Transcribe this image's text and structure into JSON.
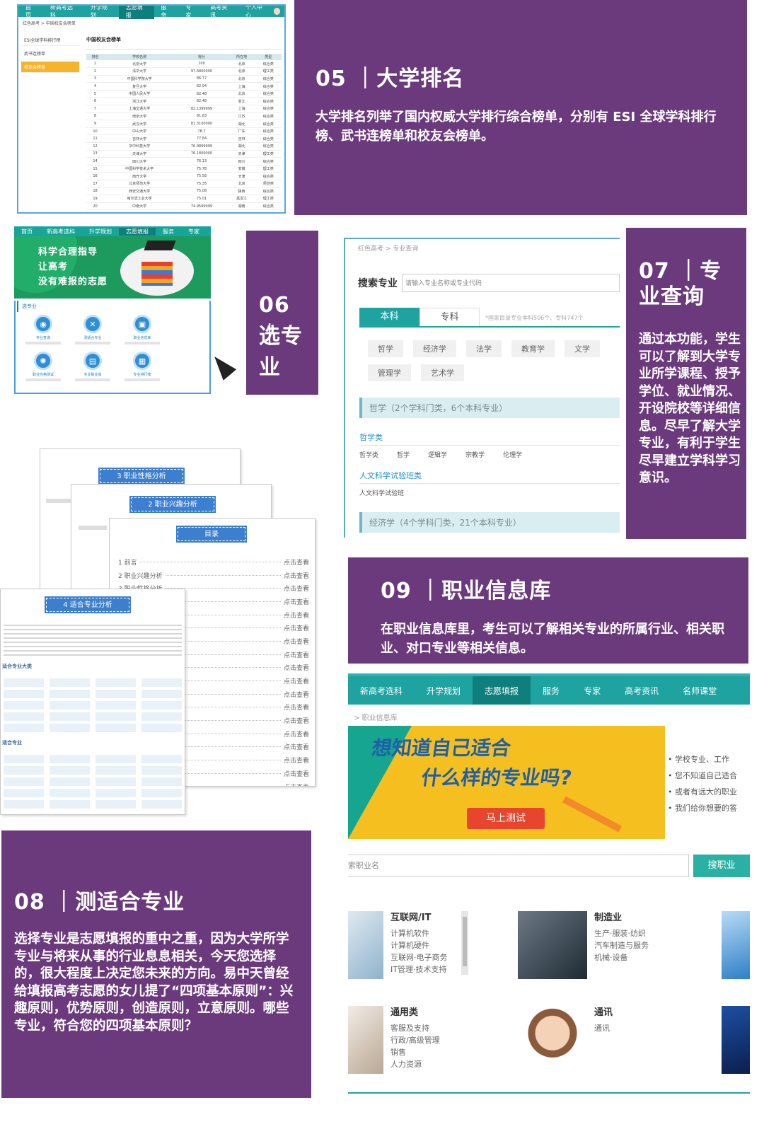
{
  "s05": {
    "title": "05 ｜大学排名",
    "body": "大学排名列举了国内权威大学排行综合榜单，分别有 ESI 全球学科排行榜、武书连榜单和校友会榜单。",
    "shot": {
      "nav": [
        "首页",
        "新高考选科",
        "升学规划",
        "志愿填报",
        "服务",
        "专家",
        "高考资讯"
      ],
      "nav_active": 3,
      "user": "个人中心",
      "breadcrumb": "红色高考 > 中国校友会榜单",
      "sidebar": [
        "ESI全球学科排行榜",
        "武书连榜单",
        "校友会榜单"
      ],
      "sidebar_active": 2,
      "panel_title": "中国校友会榜单",
      "columns": [
        "排名",
        "学校名称",
        "得分",
        "所在地",
        "类型"
      ],
      "rows": [
        [
          "1",
          "北京大学",
          "100",
          "北京",
          "综合类"
        ],
        [
          "2",
          "清华大学",
          "97.6800000",
          "北京",
          "理工类"
        ],
        [
          "3",
          "中国科学院大学",
          "86.77",
          "北京",
          "综合类"
        ],
        [
          "4",
          "复旦大学",
          "82.94",
          "上海",
          "综合类"
        ],
        [
          "5",
          "中国人民大学",
          "82.48",
          "北京",
          "综合类"
        ],
        [
          "6",
          "浙江大学",
          "82.48",
          "浙江",
          "综合类"
        ],
        [
          "7",
          "上海交通大学",
          "82.1399999",
          "上海",
          "综合类"
        ],
        [
          "8",
          "南京大学",
          "81.83",
          "江苏",
          "综合类"
        ],
        [
          "9",
          "武汉大学",
          "81.3100000",
          "湖北",
          "综合类"
        ],
        [
          "10",
          "中山大学",
          "78.7",
          "广东",
          "综合类"
        ],
        [
          "11",
          "吉林大学",
          "77.84",
          "吉林",
          "综合类"
        ],
        [
          "12",
          "华中科技大学",
          "76.9899999",
          "湖北",
          "综合类"
        ],
        [
          "13",
          "天津大学",
          "76.1800000",
          "天津",
          "理工类"
        ],
        [
          "14",
          "四川大学",
          "76.13",
          "四川",
          "综合类"
        ],
        [
          "15",
          "中国科学技术大学",
          "75.78",
          "安徽",
          "理工类"
        ],
        [
          "16",
          "南开大学",
          "75.58",
          "天津",
          "综合类"
        ],
        [
          "17",
          "北京师范大学",
          "75.35",
          "北京",
          "师范类"
        ],
        [
          "18",
          "西安交通大学",
          "75.08",
          "陕西",
          "综合类"
        ],
        [
          "19",
          "哈尔滨工业大学",
          "75.01",
          "黑龙江",
          "理工类"
        ],
        [
          "20",
          "中南大学",
          "74.9599999",
          "湖南",
          "综合类"
        ]
      ]
    }
  },
  "s06": {
    "title_num": "06 ｜",
    "title_text": "选专业",
    "banner_line1": "科学合理指导",
    "banner_line2": "让高考",
    "banner_line3": "没有难报的志愿",
    "section_label": "选专业",
    "features": [
      {
        "label": "专业查询",
        "icon": "database-icon",
        "glyph": "◉"
      },
      {
        "label": "测适合专业",
        "icon": "tools-icon",
        "glyph": "✕"
      },
      {
        "label": "职业信息库",
        "icon": "briefcase-icon",
        "glyph": "▣"
      },
      {
        "label": "职业性格测试",
        "icon": "gear-icon",
        "glyph": "✺"
      },
      {
        "label": "专业职业库",
        "icon": "book-icon",
        "glyph": "▤"
      },
      {
        "label": "专业排行榜",
        "icon": "chart-icon",
        "glyph": "▦"
      }
    ]
  },
  "s07": {
    "title": "07 ｜专业查询",
    "body": "通过本功能，学生可以了解到大学专业所学课程、授予学位、就业情况、开设院校等详细信息。尽早了解大学专业，有利于学生尽早建立学科学习意识。",
    "breadcrumb": "红色高考 > 专业查询",
    "search_label": "搜索专业",
    "search_placeholder": "请输入专业名称或专业代码",
    "tab_undergrad": "本科",
    "tab_college": "专科",
    "note": "*国家目录专业本科506个、专科747个",
    "fields_row1": [
      "哲学",
      "经济学",
      "法学",
      "教育学",
      "文学"
    ],
    "fields_row2": [
      "管理学",
      "艺术学"
    ],
    "cat1": "哲学（2个学科门类，6个本科专业）",
    "sub1_title": "哲学类",
    "sub1_items": [
      "哲学类",
      "哲学",
      "逻辑学",
      "宗教学",
      "伦理学"
    ],
    "sub2_title": "人文科学试验班类",
    "sub2_items": [
      "人文科学试验班"
    ],
    "cat2": "经济学（4个学科门类，21个本科专业）"
  },
  "s08": {
    "title": "08 ｜测适合专业",
    "body": "选择专业是志愿填报的重中之重，因为大学所学专业与将来从事的行业息息相关，今天您选择的，很大程度上决定您未来的方向。易中天曾经给填报高考志愿的女儿提了“四项基本原则”：兴趣原则，优势原则，创造原则，立意原则。哪些专业，符合您的四项基本原则？",
    "page3_tag": "3 职业性格分析",
    "page2_tag": "2 职业兴趣分析",
    "toc_tag": "目录",
    "toc": [
      {
        "label": "1 前言",
        "link": "点击查看"
      },
      {
        "label": "2 职业兴趣分析",
        "link": "点击查看"
      },
      {
        "label": "3 职业性格分析",
        "link": "点击查看"
      }
    ],
    "toc_link": "点击查看",
    "page4_tag": "4 适合专业分析",
    "page4_h1": "适合专业大类",
    "page4_h2": "适合专业"
  },
  "s09": {
    "title": "09 ｜职业信息库",
    "body": "在职业信息库里，考生可以了解相关专业的所属行业、相关职业、对口专业等相关信息。",
    "nav": [
      "新高考选科",
      "升学规划",
      "志愿填报",
      "服务",
      "专家",
      "高考资讯",
      "名师课堂"
    ],
    "nav_active": 2,
    "breadcrumb": "> 职业信息库",
    "banner_line1": "想知道自己适合",
    "banner_line2": "什么样的专业吗?",
    "banner_btn": "马上测试",
    "bullets": [
      "学校专业、工作",
      "您不知道自己适合",
      "或者有远大的职业",
      "我们给你想要的答"
    ],
    "search_placeholder": "索职业名",
    "search_btn": "搜职业",
    "cats": [
      {
        "title": "互联网/IT",
        "items": [
          "计算机软件",
          "计算机硬件",
          "互联网·电子商务",
          "IT管理·技术支持"
        ]
      },
      {
        "title": "制造业",
        "items": [
          "生产·服装·纺织",
          "汽车制造与服务",
          "机械·设备"
        ]
      },
      {
        "title": "通用类",
        "items": [
          "客服及支持",
          "行政/高级管理",
          "销售",
          "人力资源"
        ]
      },
      {
        "title": "通讯",
        "items": [
          "通讯"
        ]
      }
    ]
  }
}
